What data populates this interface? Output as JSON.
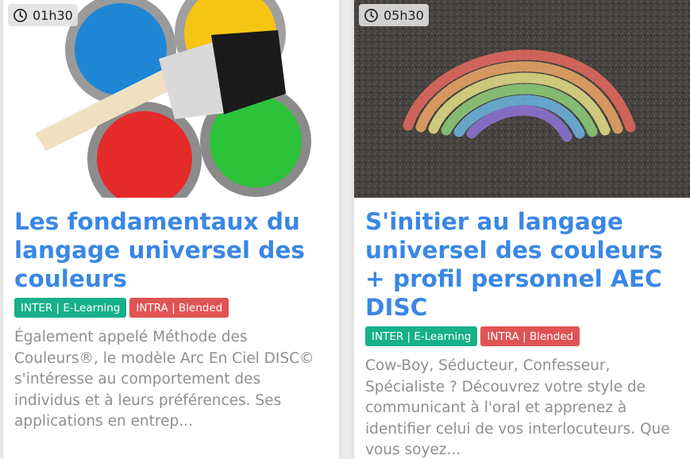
{
  "cards": [
    {
      "duration": "01h30",
      "title": "Les fondamentaux du langage universel des couleurs",
      "badges": [
        "INTER | E-Learning",
        "INTRA | Blended"
      ],
      "description": "Également appelé Méthode des Couleurs®, le modèle Arc En Ciel DISC© s'intéresse au comportement des individus et à leurs préférences. Ses applications en entrep..."
    },
    {
      "duration": "05h30",
      "title": "S'initier au langage universel des couleurs + profil personnel AEC DISC",
      "badges": [
        "INTER | E-Learning",
        "INTRA | Blended"
      ],
      "description": "Cow-Boy, Séducteur, Confesseur, Spécialiste ? Découvrez votre style de communicant à l'oral et apprenez à identifier celui de vos interlocuteurs. Que vous soyez..."
    }
  ],
  "colors": {
    "title": "#3a87e4",
    "badge_inter": "#16b08a",
    "badge_intra": "#e05353",
    "description": "#8f8f8f"
  }
}
